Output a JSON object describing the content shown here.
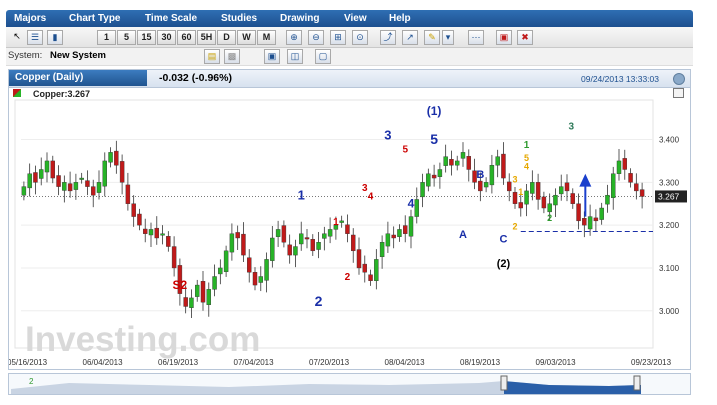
{
  "menu": [
    "Majors",
    "Chart Type",
    "Time Scale",
    "Studies",
    "Drawing",
    "View",
    "Help"
  ],
  "toolbar": {
    "timeframes": [
      "1",
      "5",
      "15",
      "30",
      "60",
      "5H",
      "D",
      "W",
      "M"
    ],
    "icons": [
      "cursor-icon",
      "bar-chart-icon",
      "candlestick-icon",
      "zoom-in-icon",
      "zoom-out-icon",
      "zoom-fit-icon",
      "zoom-reset-icon",
      "arrow-tool-icon",
      "pointer-tool-icon",
      "pencil-icon",
      "dropdown-icon",
      "line-style-icon",
      "delete-icon",
      "clear-all-icon"
    ]
  },
  "system": {
    "label": "System:",
    "value": "New System"
  },
  "panel": {
    "title": "Copper (Daily)",
    "change": "-0.032 (-0.96%)",
    "timestamp": "09/24/2013 13:33:03",
    "series_label": "Copper:3.267",
    "price_tag": "3.267"
  },
  "chart_data": {
    "type": "candlestick",
    "x_ticks": [
      "05/16/2013",
      "06/04/2013",
      "06/19/2013",
      "07/04/2013",
      "07/20/2013",
      "08/04/2013",
      "08/19/2013",
      "09/03/2013",
      "09/23/2013"
    ],
    "y_ticks": [
      3.0,
      3.1,
      3.2,
      3.3,
      3.4
    ],
    "y_tick_labels": [
      "3.000",
      "3.100",
      "3.200",
      "3.300",
      "3.400"
    ],
    "ylim": [
      2.92,
      3.49
    ],
    "last_price": 3.267,
    "support_level": 3.185,
    "closes": [
      3.29,
      3.32,
      3.3,
      3.33,
      3.35,
      3.31,
      3.29,
      3.3,
      3.28,
      3.3,
      3.31,
      3.29,
      3.27,
      3.3,
      3.35,
      3.37,
      3.34,
      3.3,
      3.25,
      3.22,
      3.2,
      3.18,
      3.19,
      3.17,
      3.18,
      3.15,
      3.1,
      3.04,
      3.01,
      3.03,
      3.06,
      3.02,
      3.05,
      3.08,
      3.1,
      3.14,
      3.18,
      3.17,
      3.13,
      3.09,
      3.06,
      3.08,
      3.12,
      3.17,
      3.19,
      3.16,
      3.13,
      3.15,
      3.18,
      3.17,
      3.14,
      3.16,
      3.18,
      3.19,
      3.2,
      3.21,
      3.18,
      3.14,
      3.1,
      3.09,
      3.07,
      3.12,
      3.16,
      3.18,
      3.17,
      3.19,
      3.18,
      3.22,
      3.26,
      3.3,
      3.32,
      3.31,
      3.33,
      3.36,
      3.34,
      3.35,
      3.37,
      3.33,
      3.3,
      3.28,
      3.3,
      3.34,
      3.36,
      3.31,
      3.28,
      3.25,
      3.24,
      3.28,
      3.3,
      3.26,
      3.24,
      3.25,
      3.27,
      3.29,
      3.28,
      3.25,
      3.21,
      3.2,
      3.22,
      3.21,
      3.24,
      3.27,
      3.32,
      3.35,
      3.33,
      3.3,
      3.28,
      3.267
    ],
    "annotations": [
      {
        "text": "S2",
        "color": "#cc0000"
      },
      {
        "text": "1",
        "color": "#1a2fa8"
      },
      {
        "text": "2",
        "color": "#1a2fa8"
      },
      {
        "text": "1",
        "color": "#cc0000"
      },
      {
        "text": "2",
        "color": "#cc0000"
      },
      {
        "text": "3",
        "color": "#cc0000"
      },
      {
        "text": "4",
        "color": "#cc0000"
      },
      {
        "text": "5",
        "color": "#cc0000"
      },
      {
        "text": "3",
        "color": "#1a2fa8"
      },
      {
        "text": "4",
        "color": "#1a2fa8"
      },
      {
        "text": "5",
        "color": "#1a2fa8"
      },
      {
        "text": "(1)",
        "color": "#1a2fa8"
      },
      {
        "text": "A",
        "color": "#1a2fa8"
      },
      {
        "text": "B",
        "color": "#1a2fa8"
      },
      {
        "text": "C",
        "color": "#1a2fa8"
      },
      {
        "text": "(2)",
        "color": "#000000"
      },
      {
        "text": "1",
        "color": "#e6a800"
      },
      {
        "text": "2",
        "color": "#e6a800"
      },
      {
        "text": "3",
        "color": "#e6a800"
      },
      {
        "text": "4",
        "color": "#e6a800"
      },
      {
        "text": "5",
        "color": "#e6a800"
      },
      {
        "text": "1",
        "color": "#2f9a2f"
      },
      {
        "text": "2",
        "color": "#2f9a2f"
      },
      {
        "text": "3",
        "color": "#2f7a5a"
      }
    ],
    "colors": {
      "up": "#27b327",
      "down": "#c01a1a",
      "arrow": "#1a3fcc"
    }
  },
  "watermark": "Investing.com",
  "navigator": {
    "label": "2"
  }
}
